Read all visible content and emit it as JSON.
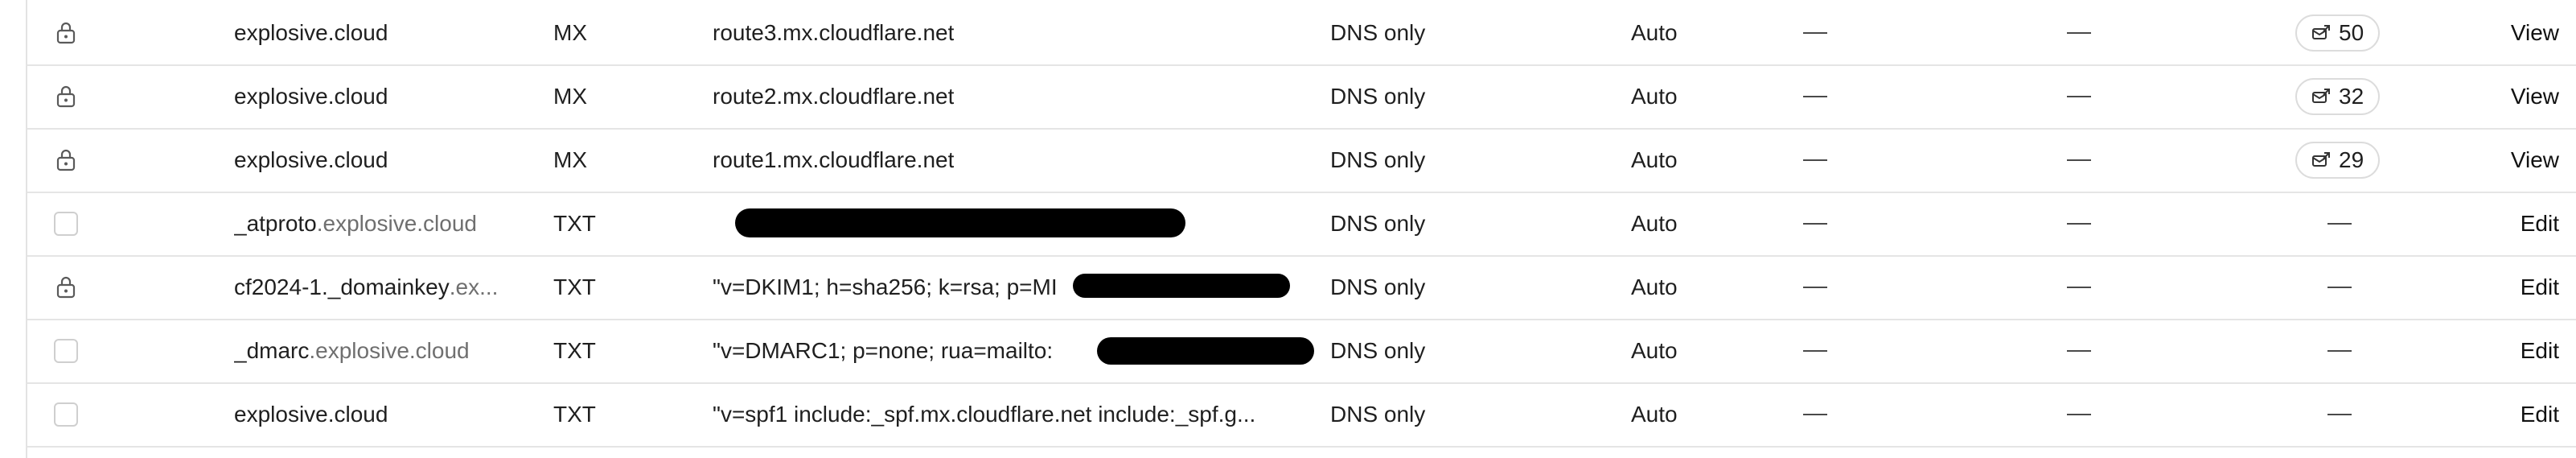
{
  "rows": [
    {
      "selector": "lock",
      "name_main": "explosive.cloud",
      "name_suffix": "",
      "type": "MX",
      "content": "route3.mx.cloudflare.net",
      "proxy_status": "DNS only",
      "ttl": "Auto",
      "priority_badge": "50",
      "action": "View"
    },
    {
      "selector": "lock",
      "name_main": "explosive.cloud",
      "name_suffix": "",
      "type": "MX",
      "content": "route2.mx.cloudflare.net",
      "proxy_status": "DNS only",
      "ttl": "Auto",
      "priority_badge": "32",
      "action": "View"
    },
    {
      "selector": "lock",
      "name_main": "explosive.cloud",
      "name_suffix": "",
      "type": "MX",
      "content": "route1.mx.cloudflare.net",
      "proxy_status": "DNS only",
      "ttl": "Auto",
      "priority_badge": "29",
      "action": "View"
    },
    {
      "selector": "checkbox",
      "name_main": "_atproto",
      "name_suffix": ".explosive.cloud",
      "type": "TXT",
      "content": "",
      "proxy_status": "DNS only",
      "ttl": "Auto",
      "priority_badge": "",
      "action": "Edit"
    },
    {
      "selector": "lock",
      "name_main": "cf2024-1._domainkey",
      "name_suffix": ".ex...",
      "type": "TXT",
      "content": "\"v=DKIM1; h=sha256; k=rsa; p=MI",
      "proxy_status": "DNS only",
      "ttl": "Auto",
      "priority_badge": "",
      "action": "Edit"
    },
    {
      "selector": "checkbox",
      "name_main": "_dmarc",
      "name_suffix": ".explosive.cloud",
      "type": "TXT",
      "content": "\"v=DMARC1; p=none; rua=mailto:",
      "proxy_status": "DNS only",
      "ttl": "Auto",
      "priority_badge": "",
      "action": "Edit"
    },
    {
      "selector": "checkbox",
      "name_main": "explosive.cloud",
      "name_suffix": "",
      "type": "TXT",
      "content": "\"v=spf1 include:_spf.mx.cloudflare.net include:_spf.g...",
      "proxy_status": "DNS only",
      "ttl": "Auto",
      "priority_badge": "",
      "action": "Edit"
    }
  ]
}
